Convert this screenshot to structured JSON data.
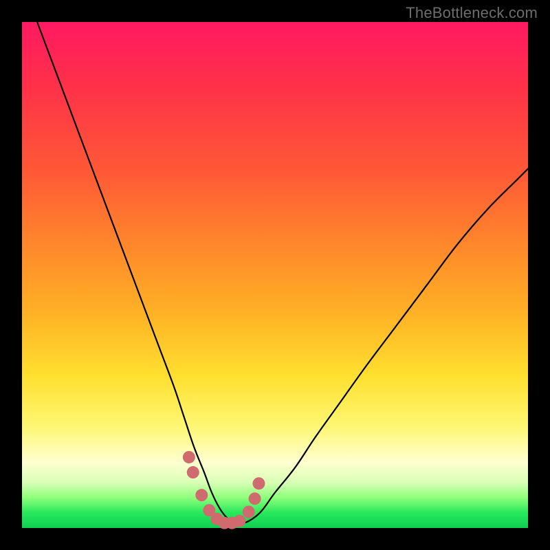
{
  "watermark": "TheBottleneck.com",
  "chart_data": {
    "type": "line",
    "title": "",
    "xlabel": "",
    "ylabel": "",
    "xlim": [
      0,
      100
    ],
    "ylim": [
      0,
      100
    ],
    "series": [
      {
        "name": "bottleneck-curve",
        "x": [
          3,
          6,
          9,
          12,
          15,
          18,
          21,
          24,
          27,
          30,
          32,
          34,
          36,
          37.5,
          39,
          40.5,
          42,
          44,
          47,
          50,
          54,
          58,
          63,
          68,
          74,
          80,
          86,
          92,
          98,
          100
        ],
        "y": [
          100,
          92,
          84,
          76,
          68,
          60,
          52,
          44,
          36,
          28,
          22,
          16,
          11,
          7,
          4,
          2,
          1,
          1,
          3,
          7,
          12,
          18,
          25,
          32,
          40,
          48,
          56,
          63,
          69,
          71
        ]
      }
    ],
    "markers": {
      "name": "highlight-points",
      "x": [
        33.0,
        33.8,
        35.5,
        37.0,
        38.5,
        40.0,
        41.5,
        43.0,
        44.8,
        46.0,
        46.8
      ],
      "y": [
        14.0,
        11.0,
        6.5,
        3.5,
        1.8,
        1.0,
        1.0,
        1.4,
        3.2,
        5.8,
        8.8
      ],
      "r": 9
    }
  }
}
